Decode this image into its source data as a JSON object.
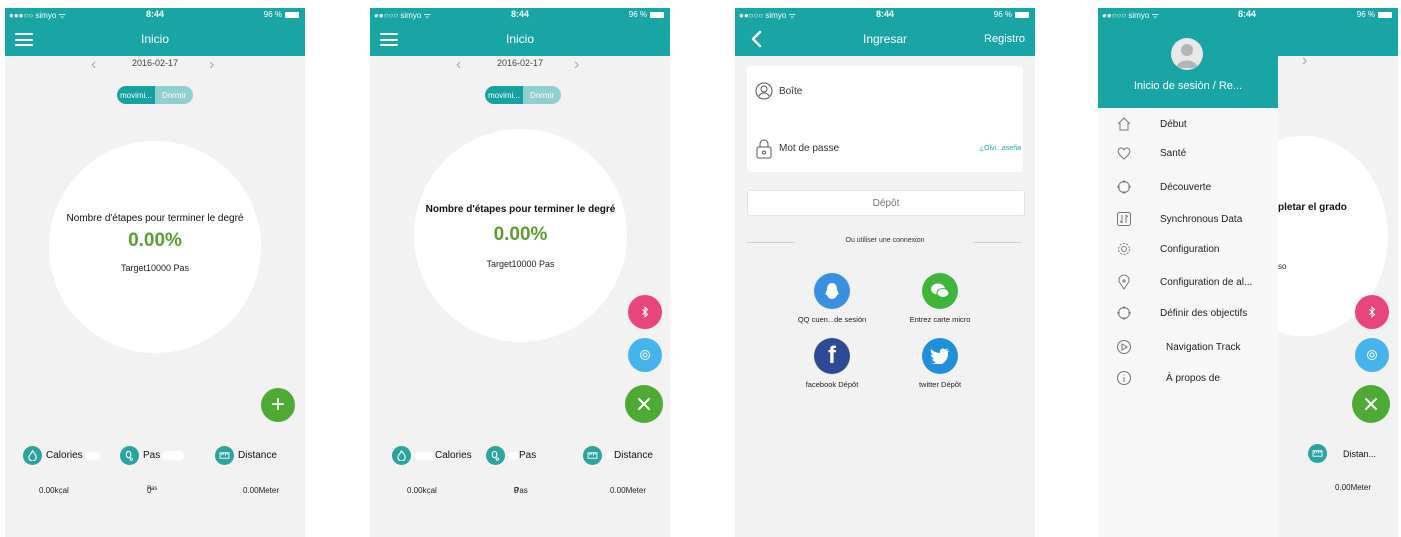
{
  "status": {
    "carrier": "simyo",
    "time": "8:44",
    "battery": "96 %"
  },
  "screen1": {
    "title": "Inicio",
    "date": "2016-02-17",
    "seg_move": "movimi...",
    "seg_sleep": "Dormir",
    "circle_label": "Nombre d'étapes pour terminer le degré",
    "percent": "0.00%",
    "target": "Target10000",
    "target_unit": "Pas",
    "stats": [
      {
        "label": "Calories",
        "value": "0.00kcal"
      },
      {
        "label": "Pas",
        "value": "0",
        "unit": "Pas"
      },
      {
        "label": "Distance",
        "value": "0.00Meter"
      }
    ],
    "fab_symbol": "+"
  },
  "screen2": {
    "title": "Inicio",
    "date": "2016-02-17",
    "seg_move": "movimi...",
    "seg_sleep": "Dormir",
    "circle_label": "Nombre d'étapes pour terminer le degré",
    "percent": "0.00%",
    "target": "Target10000",
    "target_unit": "Pas",
    "stats": [
      {
        "label": "Calories",
        "value": "0.00kcal"
      },
      {
        "label": "Pas",
        "value": "0",
        "unit": "Pas"
      },
      {
        "label": "Distance",
        "value": "0.00Meter"
      }
    ]
  },
  "screen3": {
    "title": "Ingresar",
    "register": "Registro",
    "email_label": "Boîte",
    "password_label": "Mot de passe",
    "forgot": "¿Olvi...aseña",
    "login_button": "Dépôt",
    "or_text": "Ou utiliser une connexion",
    "socials": [
      {
        "label": "QQ cuen...de sesión",
        "icon": "qq-icon",
        "color": "#3b8fe0"
      },
      {
        "label": "Entrez carte micro",
        "icon": "wechat-icon",
        "color": "#3fb53a"
      },
      {
        "label": "facebook",
        "sub": "Dépôt",
        "icon": "facebook-icon",
        "color": "#2d4a94"
      },
      {
        "label": "twitter",
        "sub": "Dépôt",
        "icon": "twitter-icon",
        "color": "#1f8fdb"
      }
    ]
  },
  "screen4": {
    "login_text": "Inicio de sesión / Re...",
    "menu": [
      {
        "label": "Début",
        "icon": "home-icon"
      },
      {
        "label": "Santé",
        "icon": "heart-icon"
      },
      {
        "label": "Découverte",
        "icon": "crosshair-icon"
      },
      {
        "label": "Synchronous Data",
        "icon": "sync-icon"
      },
      {
        "label": "Configuration",
        "icon": "gear-icon"
      },
      {
        "label": "Configuration",
        "extra": "de al...",
        "icon": "alarm-pin-icon"
      },
      {
        "label": "Définir des objectifs",
        "icon": "target-icon"
      },
      {
        "label": "Navigation",
        "extra": "Track",
        "icon": "navigation-icon"
      },
      {
        "label": "À propos de",
        "icon": "info-icon"
      }
    ],
    "bg_text": "pletar el grado",
    "bg_text2": "so",
    "bg_distance": "Distan...",
    "bg_distance_value": "0.00Meter"
  },
  "colors": {
    "teal": "#1aa5a5",
    "green": "#5a9e32",
    "pink": "#e8457a",
    "blue": "#45b3ec",
    "fab_green": "#4caa35"
  }
}
